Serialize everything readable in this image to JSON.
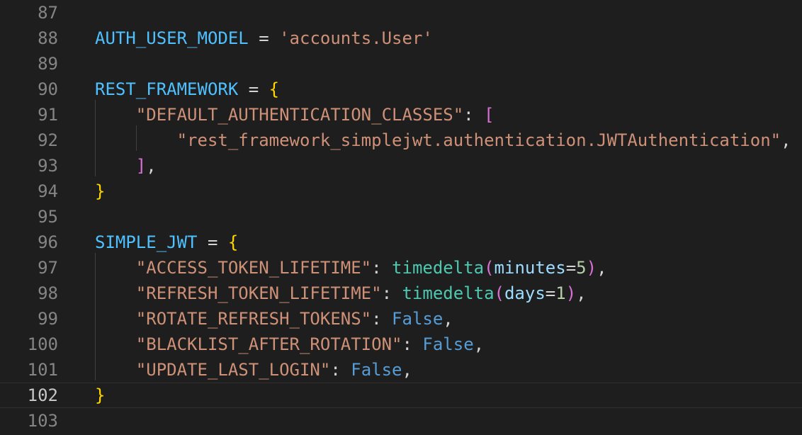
{
  "lines": [
    {
      "num": "87",
      "tokens": []
    },
    {
      "num": "88",
      "tokens": [
        {
          "text": "AUTH_USER_MODEL",
          "kind": "var"
        },
        {
          "text": " = ",
          "kind": "op"
        },
        {
          "text": "'accounts.User'",
          "kind": "str"
        }
      ]
    },
    {
      "num": "89",
      "tokens": []
    },
    {
      "num": "90",
      "tokens": [
        {
          "text": "REST_FRAMEWORK",
          "kind": "var"
        },
        {
          "text": " = ",
          "kind": "op"
        },
        {
          "text": "{",
          "kind": "brace"
        }
      ]
    },
    {
      "num": "91",
      "tokens": [
        {
          "text": "    ",
          "kind": "op"
        },
        {
          "text": "\"DEFAULT_AUTHENTICATION_CLASSES\"",
          "kind": "str"
        },
        {
          "text": ": ",
          "kind": "op"
        },
        {
          "text": "[",
          "kind": "bracket"
        }
      ]
    },
    {
      "num": "92",
      "tokens": [
        {
          "text": "        ",
          "kind": "op"
        },
        {
          "text": "\"rest_framework_simplejwt.authentication.JWTAuthentication\"",
          "kind": "str"
        },
        {
          "text": ",",
          "kind": "op"
        }
      ]
    },
    {
      "num": "93",
      "tokens": [
        {
          "text": "    ",
          "kind": "op"
        },
        {
          "text": "]",
          "kind": "bracket"
        },
        {
          "text": ",",
          "kind": "op"
        }
      ]
    },
    {
      "num": "94",
      "tokens": [
        {
          "text": "}",
          "kind": "brace"
        }
      ]
    },
    {
      "num": "95",
      "tokens": []
    },
    {
      "num": "96",
      "tokens": [
        {
          "text": "SIMPLE_JWT",
          "kind": "var"
        },
        {
          "text": " = ",
          "kind": "op"
        },
        {
          "text": "{",
          "kind": "brace"
        }
      ]
    },
    {
      "num": "97",
      "tokens": [
        {
          "text": "    ",
          "kind": "op"
        },
        {
          "text": "\"ACCESS_TOKEN_LIFETIME\"",
          "kind": "str"
        },
        {
          "text": ": ",
          "kind": "op"
        },
        {
          "text": "timedelta",
          "kind": "fn"
        },
        {
          "text": "(",
          "kind": "paren"
        },
        {
          "text": "minutes",
          "kind": "param"
        },
        {
          "text": "=",
          "kind": "op"
        },
        {
          "text": "5",
          "kind": "num"
        },
        {
          "text": ")",
          "kind": "paren"
        },
        {
          "text": ",",
          "kind": "op"
        }
      ]
    },
    {
      "num": "98",
      "tokens": [
        {
          "text": "    ",
          "kind": "op"
        },
        {
          "text": "\"REFRESH_TOKEN_LIFETIME\"",
          "kind": "str"
        },
        {
          "text": ": ",
          "kind": "op"
        },
        {
          "text": "timedelta",
          "kind": "fn"
        },
        {
          "text": "(",
          "kind": "paren"
        },
        {
          "text": "days",
          "kind": "param"
        },
        {
          "text": "=",
          "kind": "op"
        },
        {
          "text": "1",
          "kind": "num"
        },
        {
          "text": ")",
          "kind": "paren"
        },
        {
          "text": ",",
          "kind": "op"
        }
      ]
    },
    {
      "num": "99",
      "tokens": [
        {
          "text": "    ",
          "kind": "op"
        },
        {
          "text": "\"ROTATE_REFRESH_TOKENS\"",
          "kind": "str"
        },
        {
          "text": ": ",
          "kind": "op"
        },
        {
          "text": "False",
          "kind": "kw"
        },
        {
          "text": ",",
          "kind": "op"
        }
      ]
    },
    {
      "num": "100",
      "tokens": [
        {
          "text": "    ",
          "kind": "op"
        },
        {
          "text": "\"BLACKLIST_AFTER_ROTATION\"",
          "kind": "str"
        },
        {
          "text": ": ",
          "kind": "op"
        },
        {
          "text": "False",
          "kind": "kw"
        },
        {
          "text": ",",
          "kind": "op"
        }
      ]
    },
    {
      "num": "101",
      "tokens": [
        {
          "text": "    ",
          "kind": "op"
        },
        {
          "text": "\"UPDATE_LAST_LOGIN\"",
          "kind": "str"
        },
        {
          "text": ": ",
          "kind": "op"
        },
        {
          "text": "False",
          "kind": "kw"
        },
        {
          "text": ",",
          "kind": "op"
        }
      ]
    },
    {
      "num": "102",
      "tokens": [
        {
          "text": "}",
          "kind": "brace"
        }
      ],
      "current": true
    },
    {
      "num": "103",
      "tokens": []
    }
  ],
  "colors": {
    "background": "#1e1e1e",
    "line_number": "#858585",
    "line_number_active": "#c6c6c6",
    "variable": "#4fc1ff",
    "string": "#ce9178",
    "brace": "#ffd700",
    "bracket": "#da70d6",
    "function": "#4ec9b0",
    "parameter": "#9cdcfe",
    "number": "#b5cea8",
    "keyword": "#569cd6"
  }
}
